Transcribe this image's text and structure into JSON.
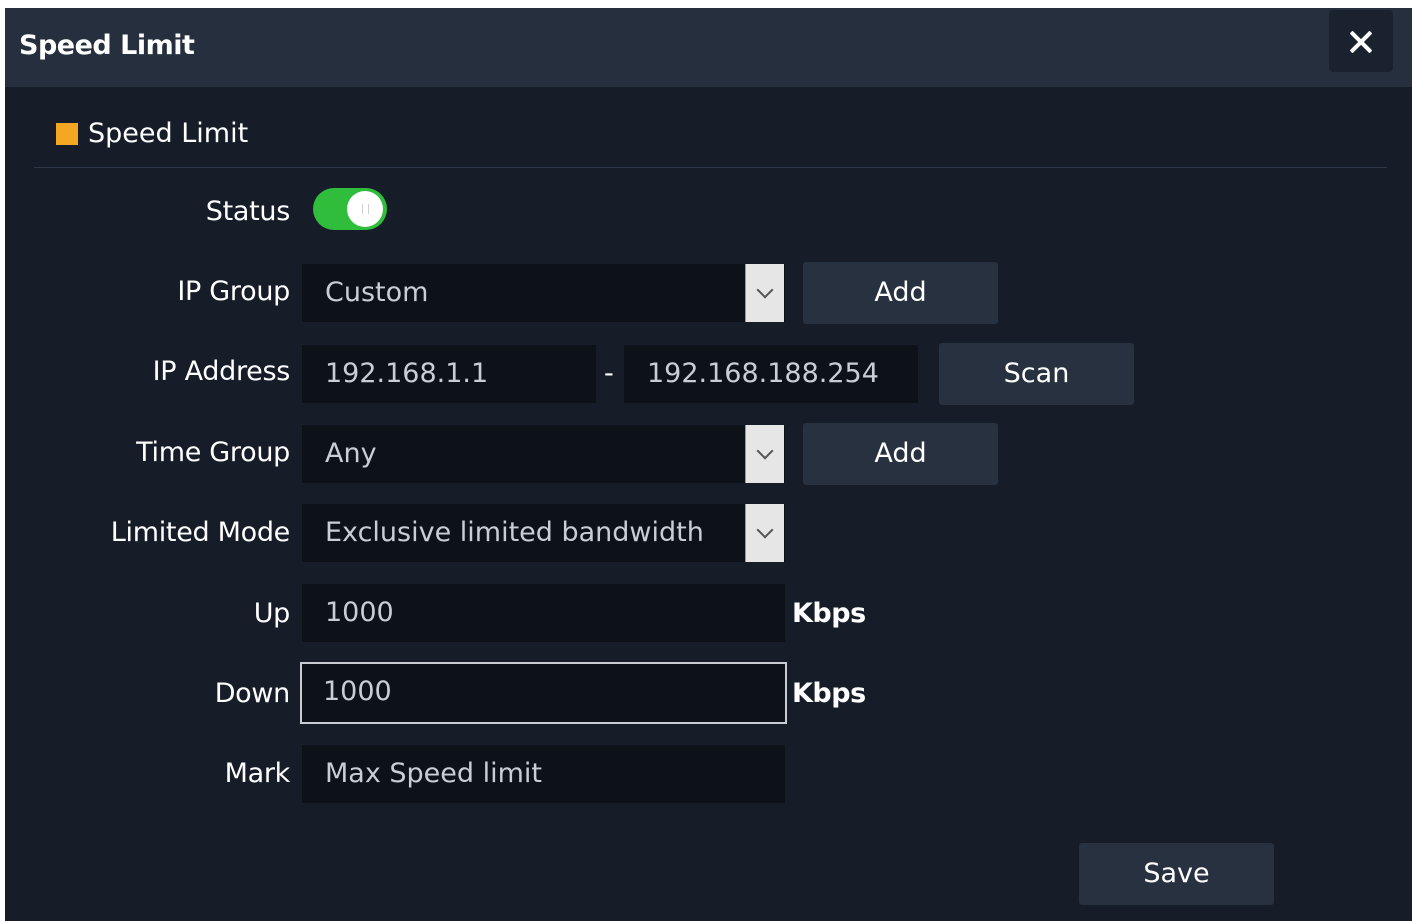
{
  "dialog": {
    "title": "Speed Limit",
    "close_icon": "close-icon"
  },
  "section": {
    "title": "Speed Limit",
    "marker_color": "#f5a623"
  },
  "form": {
    "status": {
      "label": "Status",
      "enabled": true,
      "on_color": "#2fbd3b"
    },
    "ip_group": {
      "label": "IP Group",
      "value": "Custom",
      "add_label": "Add"
    },
    "ip_address": {
      "label": "IP Address",
      "start": "192.168.1.1",
      "separator": "-",
      "end": "192.168.188.254",
      "scan_label": "Scan"
    },
    "time_group": {
      "label": "Time Group",
      "value": "Any",
      "add_label": "Add"
    },
    "limited_mode": {
      "label": "Limited Mode",
      "value": "Exclusive limited bandwidth"
    },
    "up": {
      "label": "Up",
      "value": "1000",
      "unit": "Kbps"
    },
    "down": {
      "label": "Down",
      "value": "1000",
      "unit": "Kbps"
    },
    "mark": {
      "label": "Mark",
      "value": "Max Speed limit"
    }
  },
  "actions": {
    "save_label": "Save"
  }
}
